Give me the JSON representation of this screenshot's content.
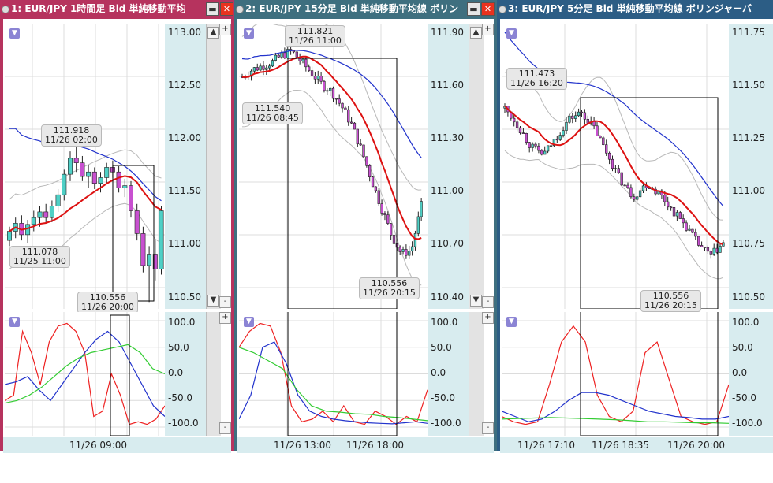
{
  "colors": {
    "candle_up": "#4fd0c6",
    "candle_down": "#c850d0",
    "sma_red": "#dd1111",
    "sma_blue": "#2233cc",
    "band": "#b8b8b8",
    "osc_red": "#ee2222",
    "osc_blue": "#2233cc",
    "osc_green": "#33cc33",
    "axis_bg": "#d8ecef",
    "title_w1": "#b6335e",
    "title_w2": "#3e6f7f",
    "title_w3": "#2c5d85"
  },
  "windows": [
    {
      "title": "1: EUR/JPY 1時間足 Bid 単純移動平均",
      "price_ticks": [
        "113.00",
        "112.50",
        "112.00",
        "111.50",
        "111.00",
        "110.50"
      ],
      "osc_ticks": [
        "100.0",
        "50.0",
        "0.0",
        "-50.0",
        "-100.0"
      ],
      "x_labels": [
        "11/26 09:00"
      ],
      "callouts": [
        {
          "line1": "111.918",
          "line2": "11/26 02:00"
        },
        {
          "line1": "111.078",
          "line2": "11/25 11:00"
        },
        {
          "line1": "110.556",
          "line2": "11/26 20:00"
        }
      ],
      "buttons": {
        "plus": "+",
        "minus": "-",
        "menu": "▼"
      },
      "chart_data": {
        "type": "candlestick",
        "ylim": [
          110.5,
          113.0
        ],
        "osc_ylim": [
          -100,
          100
        ],
        "candles": [
          {
            "o": 111.1,
            "h": 111.22,
            "l": 111.05,
            "c": 111.18
          },
          {
            "o": 111.18,
            "h": 111.3,
            "l": 111.12,
            "c": 111.25
          },
          {
            "o": 111.25,
            "h": 111.32,
            "l": 111.1,
            "c": 111.15
          },
          {
            "o": 111.15,
            "h": 111.28,
            "l": 111.08,
            "c": 111.24
          },
          {
            "o": 111.24,
            "h": 111.36,
            "l": 111.18,
            "c": 111.3
          },
          {
            "o": 111.3,
            "h": 111.4,
            "l": 111.22,
            "c": 111.35
          },
          {
            "o": 111.35,
            "h": 111.42,
            "l": 111.25,
            "c": 111.3
          },
          {
            "o": 111.3,
            "h": 111.45,
            "l": 111.26,
            "c": 111.4
          },
          {
            "o": 111.4,
            "h": 111.55,
            "l": 111.35,
            "c": 111.5
          },
          {
            "o": 111.5,
            "h": 111.72,
            "l": 111.45,
            "c": 111.68
          },
          {
            "o": 111.68,
            "h": 111.88,
            "l": 111.62,
            "c": 111.82
          },
          {
            "o": 111.82,
            "h": 111.92,
            "l": 111.7,
            "c": 111.78
          },
          {
            "o": 111.78,
            "h": 111.84,
            "l": 111.62,
            "c": 111.66
          },
          {
            "o": 111.66,
            "h": 111.76,
            "l": 111.56,
            "c": 111.7
          },
          {
            "o": 111.7,
            "h": 111.74,
            "l": 111.55,
            "c": 111.6
          },
          {
            "o": 111.6,
            "h": 111.7,
            "l": 111.52,
            "c": 111.65
          },
          {
            "o": 111.65,
            "h": 111.78,
            "l": 111.6,
            "c": 111.74
          },
          {
            "o": 111.74,
            "h": 111.8,
            "l": 111.65,
            "c": 111.7
          },
          {
            "o": 111.7,
            "h": 111.75,
            "l": 111.52,
            "c": 111.56
          },
          {
            "o": 111.56,
            "h": 111.64,
            "l": 111.48,
            "c": 111.58
          },
          {
            "o": 111.58,
            "h": 111.62,
            "l": 111.3,
            "c": 111.36
          },
          {
            "o": 111.36,
            "h": 111.42,
            "l": 111.1,
            "c": 111.16
          },
          {
            "o": 111.16,
            "h": 111.22,
            "l": 110.82,
            "c": 110.88
          },
          {
            "o": 110.88,
            "h": 111.05,
            "l": 110.56,
            "c": 110.98
          },
          {
            "o": 110.98,
            "h": 111.1,
            "l": 110.75,
            "c": 110.85
          },
          {
            "o": 110.85,
            "h": 111.4,
            "l": 110.8,
            "c": 111.36
          }
        ]
      }
    },
    {
      "title": "2: EUR/JPY 15分足 Bid 単純移動平均線 ボリン",
      "price_ticks": [
        "111.90",
        "111.60",
        "111.30",
        "111.00",
        "110.70",
        "110.40"
      ],
      "osc_ticks": [
        "100.0",
        "50.0",
        "0.0",
        "-50.0",
        "-100.0"
      ],
      "x_labels": [
        "11/26 13:00",
        "11/26 18:00"
      ],
      "callouts": [
        {
          "line1": "111.821",
          "line2": "11/26 11:00"
        },
        {
          "line1": "111.540",
          "line2": "11/26 08:45"
        },
        {
          "line1": "110.556",
          "line2": "11/26 20:15"
        }
      ],
      "buttons": {
        "plus": "+",
        "minus": "-",
        "menu": "▼"
      },
      "chart_data": {
        "type": "candlestick",
        "ylim": [
          110.4,
          111.95
        ],
        "osc_ylim": [
          -100,
          100
        ]
      }
    },
    {
      "title": "3: EUR/JPY 5分足 Bid 単純移動平均線 ボリンジャーバ",
      "price_ticks": [
        "111.75",
        "111.50",
        "111.25",
        "111.00",
        "110.75",
        "110.50"
      ],
      "osc_ticks": [
        "100.0",
        "50.0",
        "0.0",
        "-50.0",
        "-100.0"
      ],
      "x_labels": [
        "11/26 17:10",
        "11/26 18:35",
        "11/26 20:00"
      ],
      "callouts": [
        {
          "line1": "111.473",
          "line2": "11/26 16:20"
        },
        {
          "line1": "110.556",
          "line2": "11/26 20:15"
        }
      ],
      "buttons": {
        "plus": "+",
        "minus": "-",
        "menu": "▼"
      },
      "chart_data": {
        "type": "candlestick",
        "ylim": [
          110.45,
          111.8
        ],
        "osc_ylim": [
          -100,
          100
        ]
      }
    }
  ]
}
